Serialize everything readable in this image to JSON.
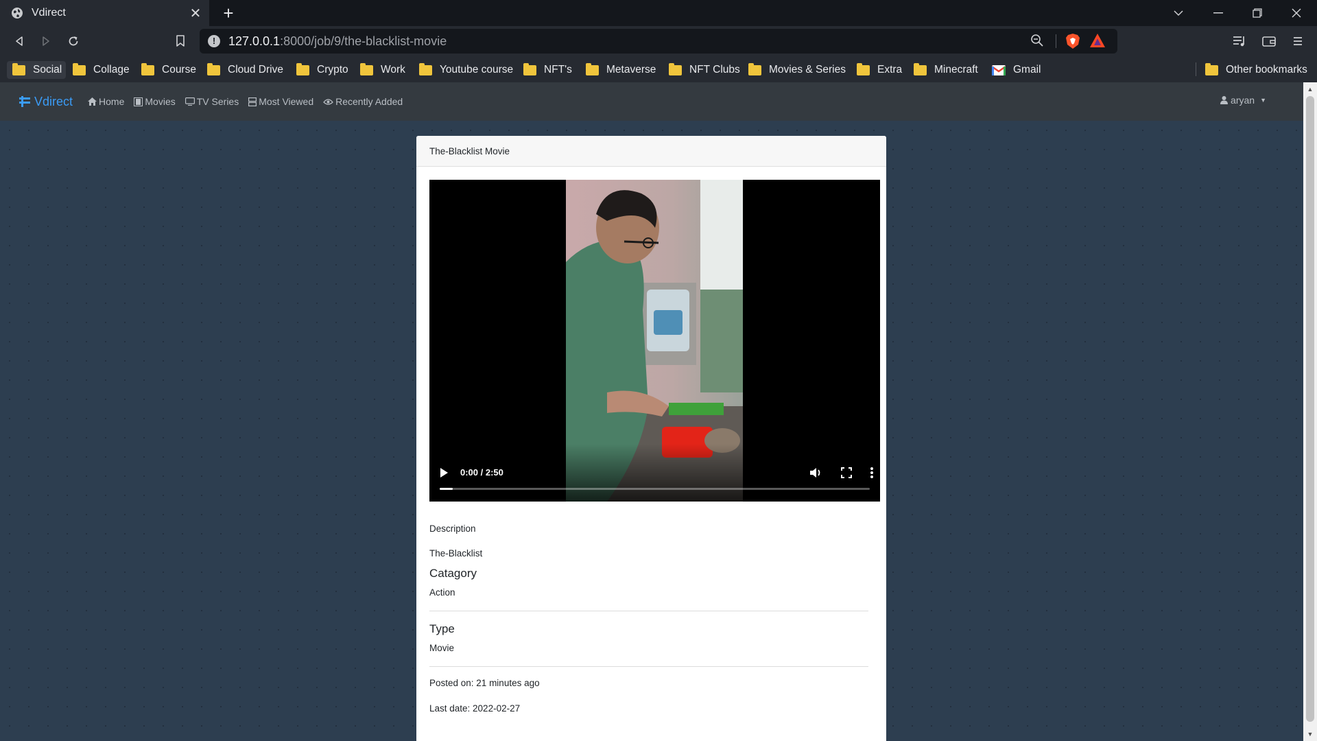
{
  "browser": {
    "tab_title": "Vdirect",
    "tab_close": "✕",
    "new_tab": "+",
    "url_host": "127.0.0.1",
    "url_rest": ":8000/job/9/the-blacklist-movie",
    "bookmarks": [
      {
        "label": "Social"
      },
      {
        "label": "Collage"
      },
      {
        "label": "Course"
      },
      {
        "label": "Cloud Drive"
      },
      {
        "label": "Crypto"
      },
      {
        "label": "Work"
      },
      {
        "label": "Youtube course"
      },
      {
        "label": "NFT's"
      },
      {
        "label": "Metaverse"
      },
      {
        "label": "NFT Clubs"
      },
      {
        "label": "Movies & Series"
      },
      {
        "label": "Extra"
      },
      {
        "label": "Minecraft"
      },
      {
        "label": "Gmail"
      }
    ],
    "other_bookmarks": "Other bookmarks"
  },
  "navbar": {
    "brand": "Vdirect",
    "links": [
      {
        "label": "Home",
        "icon": "home-icon"
      },
      {
        "label": "Movies",
        "icon": "film-icon"
      },
      {
        "label": "TV Series",
        "icon": "tv-icon"
      },
      {
        "label": "Most Viewed",
        "icon": "list-icon"
      },
      {
        "label": "Recently Added",
        "icon": "eye-icon"
      }
    ],
    "user": "aryan"
  },
  "card": {
    "header": "The-Blacklist Movie",
    "video": {
      "time": "0:00 / 2:50",
      "progress": 0.03
    },
    "description_label": "Description",
    "description": "The-Blacklist",
    "category_heading": "Catagory",
    "category": "Action",
    "type_heading": "Type",
    "type": "Movie",
    "posted_on": "Posted on: 21 minutes ago",
    "last_date": "Last date: 2022-02-27"
  },
  "colors": {
    "page_bg": "#2d3e50",
    "navbar_bg": "#343a40",
    "brand": "#3b9bf5",
    "folder": "#f0c53c"
  }
}
